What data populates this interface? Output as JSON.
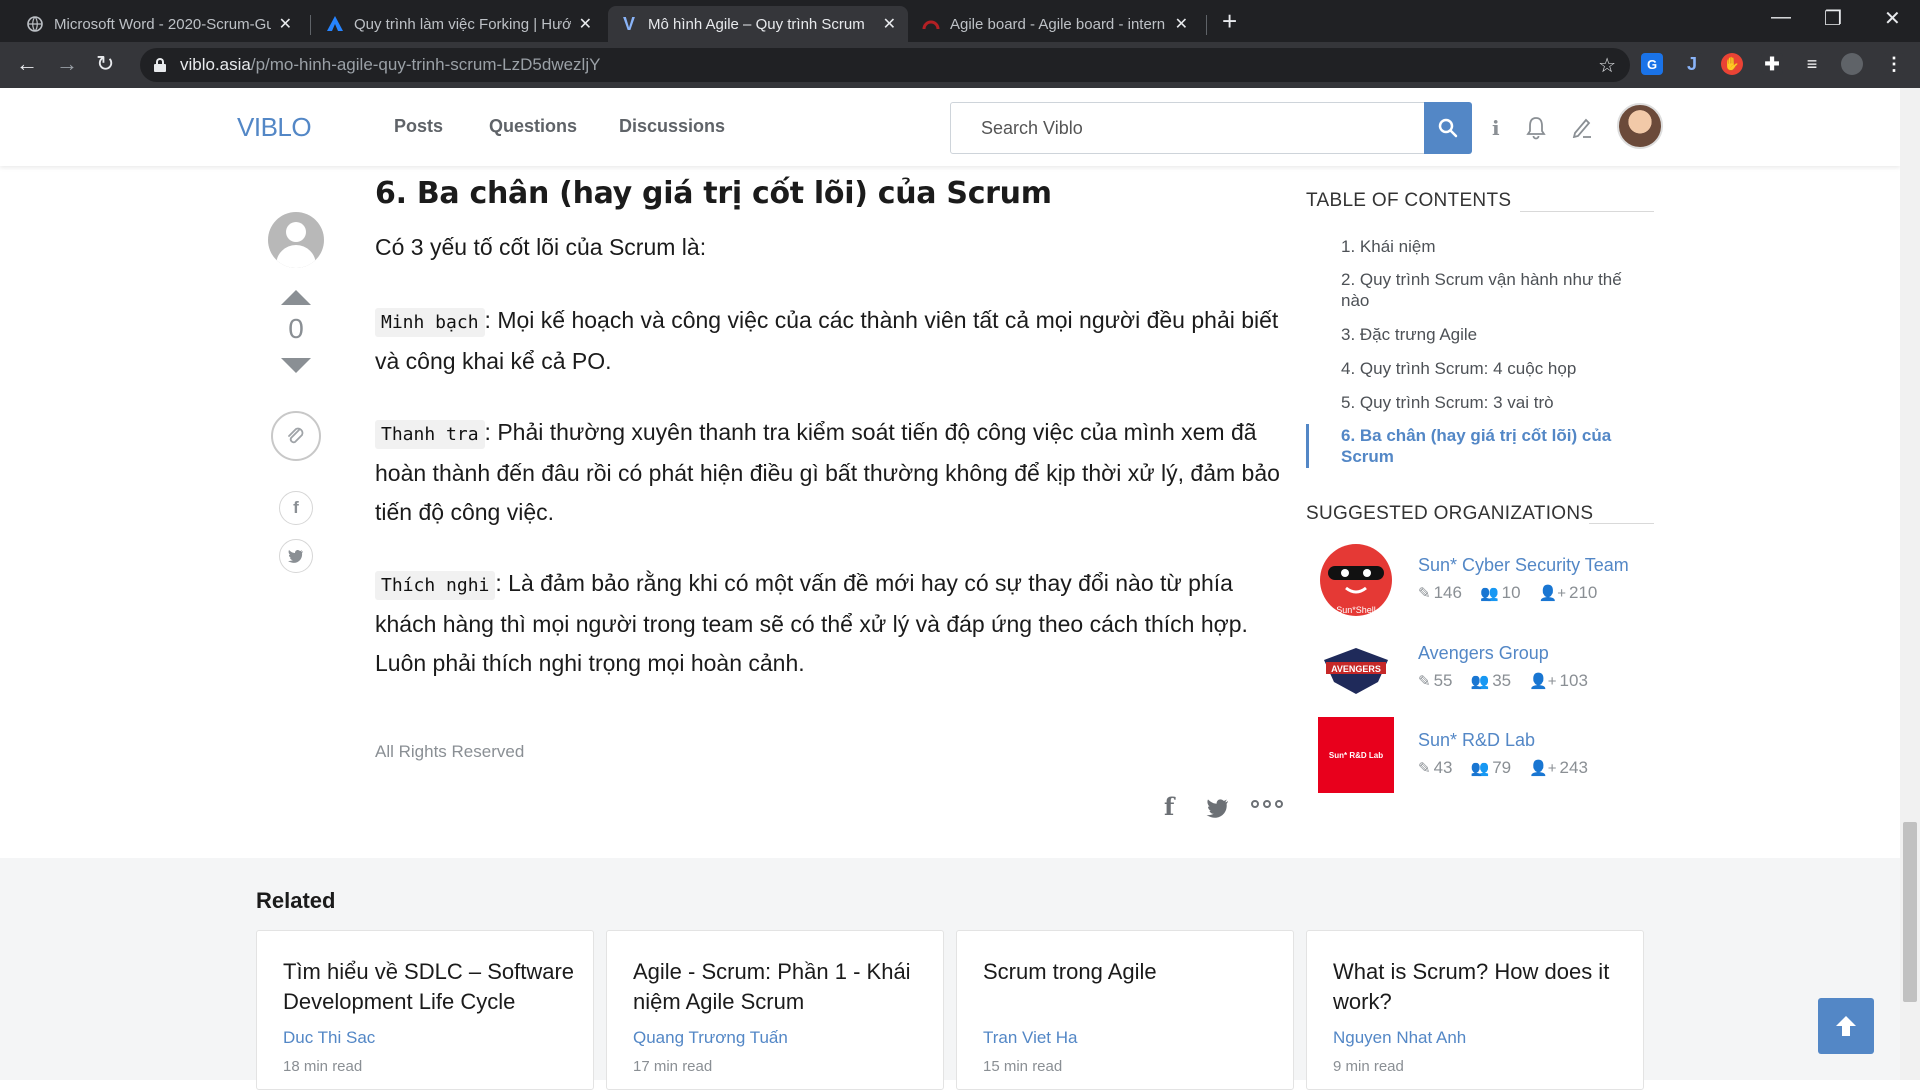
{
  "browser": {
    "tabs": [
      {
        "title": "Microsoft Word - 2020-Scrum-Gu",
        "icon": "globe-icon"
      },
      {
        "title": "Quy trình làm việc Forking | Hướ",
        "icon": "atlassian-icon"
      },
      {
        "title": "Mô hình Agile – Quy trình Scrum",
        "icon": "viblo-icon"
      },
      {
        "title": "Agile board - Agile board - intern",
        "icon": "redmine-icon"
      }
    ],
    "url_host": "viblo.asia",
    "url_path": "/p/mo-hinh-agile-quy-trinh-scrum-LzD5dwezljY"
  },
  "site": {
    "logo": "VIBLO",
    "nav": [
      "Posts",
      "Questions",
      "Discussions"
    ],
    "search_placeholder": "Search Viblo"
  },
  "article": {
    "heading": "6. Ba chân (hay giá trị cốt lõi) của Scrum",
    "intro": "Có 3 yếu tố cốt lõi của Scrum là:",
    "items": [
      {
        "term": "Minh bạch",
        "text": ": Mọi kế hoạch và công việc của các thành viên tất cả mọi người đều phải biết và công khai kể cả PO."
      },
      {
        "term": "Thanh tra",
        "text": ": Phải thường xuyên thanh tra kiểm soát tiến độ công việc của mình xem đã hoàn thành đến đâu rồi có phát hiện điều gì bất thường không để kịp thời xử lý, đảm bảo tiến độ công việc."
      },
      {
        "term": "Thích nghi",
        "text": ": Là đảm bảo rằng khi có một vấn đề mới hay có sự thay đổi nào từ phía khách hàng thì mọi người trong team sẽ có thể xử lý và đáp ứng theo cách thích hợp. Luôn phải thích nghi trọng mọi hoàn cảnh."
      }
    ],
    "rights": "All Rights Reserved",
    "vote_count": "0"
  },
  "toc": {
    "title": "TABLE OF CONTENTS",
    "items": [
      "1. Khái niệm",
      "2. Quy trình Scrum vận hành như thế nào",
      "3. Đặc trưng Agile",
      "4. Quy trình Scrum: 4 cuộc họp",
      "5. Quy trình Scrum: 3 vai trò",
      "6. Ba chân (hay giá trị cốt lõi) của Scrum"
    ],
    "active_index": 5
  },
  "organizations": {
    "title": "SUGGESTED ORGANIZATIONS",
    "items": [
      {
        "name": "Sun* Cyber Security Team",
        "logo_text": "Sun*Shell",
        "posts": "146",
        "members": "10",
        "followers": "210"
      },
      {
        "name": "Avengers Group",
        "logo_text": "AVENGERS",
        "posts": "55",
        "members": "35",
        "followers": "103"
      },
      {
        "name": "Sun* R&D Lab",
        "logo_text": "Sun* R&D Lab",
        "posts": "43",
        "members": "79",
        "followers": "243"
      }
    ]
  },
  "related": {
    "title": "Related",
    "cards": [
      {
        "title": "Tìm hiểu về SDLC – Software Development Life Cycle",
        "author": "Duc Thi Sac",
        "read": "18 min read"
      },
      {
        "title": "Agile - Scrum: Phần 1 - Khái niệm Agile Scrum",
        "author": "Quang Trương Tuấn",
        "read": "17 min read"
      },
      {
        "title": "Scrum trong Agile",
        "author": "Tran Viet Ha",
        "read": "15 min read"
      },
      {
        "title": "What is Scrum? How does it work?",
        "author": "Nguyen Nhat Anh",
        "read": "9 min read"
      }
    ]
  },
  "colors": {
    "brand": "#5387c6",
    "chrome_dark": "#202124",
    "chrome_toolbar": "#35363a"
  }
}
